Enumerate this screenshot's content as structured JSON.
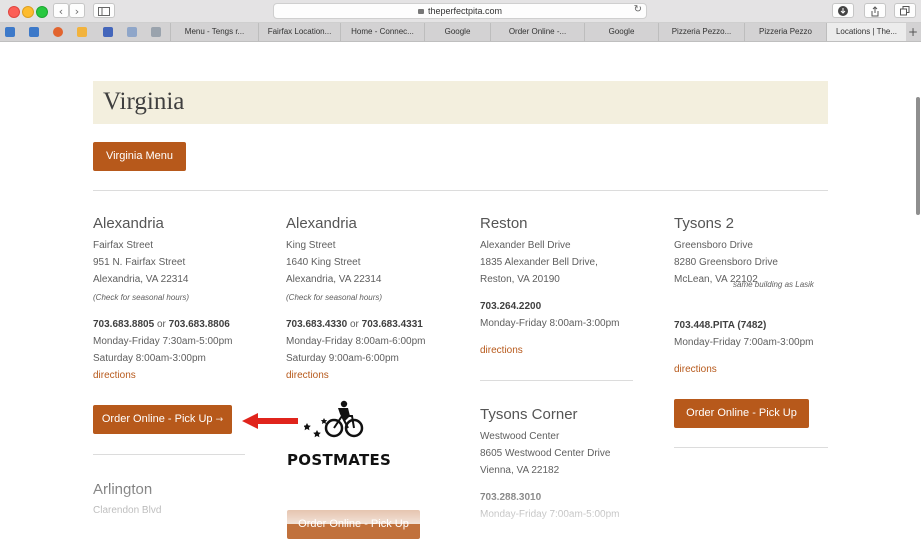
{
  "browser": {
    "url": "theperfectpita.com",
    "tabs": [
      "Menu - Tengs r...",
      "Fairfax Location...",
      "Home - Connec...",
      "Google",
      "Order Online -...",
      "Google",
      "Pizzeria Pezzo...",
      "Pizzeria Pezzo",
      "Locations | The..."
    ]
  },
  "page": {
    "title": "Virginia",
    "menu_button": "Virginia Menu",
    "locations": [
      {
        "city": "Alexandria",
        "street": "Fairfax Street",
        "address": "951 N. Fairfax Street",
        "citystate": "Alexandria, VA 22314",
        "note": "(Check for seasonal hours)",
        "phone1": "703.683.8805",
        "or": "or",
        "phone2": "703.683.8806",
        "hours1": "Monday-Friday 7:30am-5:00pm",
        "hours2": "Saturday 8:00am-3:00pm",
        "directions": "directions",
        "order": "Order Online - Pick Up",
        "arrow": "→"
      },
      {
        "city": "Alexandria",
        "street": "King Street",
        "address": "1640 King Street",
        "citystate": "Alexandria, VA 22314",
        "note": "(Check for seasonal hours)",
        "phone1": "703.683.4330",
        "or": "or",
        "phone2": "703.683.4331",
        "hours1": "Monday-Friday 8:00am-6:00pm",
        "hours2": "Saturday 9:00am-6:00pm",
        "directions": "directions"
      },
      {
        "city": "Reston",
        "street": "Alexander Bell Drive",
        "address": "1835 Alexander Bell Drive,",
        "citystate": "Reston, VA 20190",
        "phone": "703.264.2200",
        "hours": "Monday-Friday 8:00am-3:00pm",
        "directions": "directions"
      },
      {
        "city": "Tysons 2",
        "street": "Greensboro Drive",
        "address": "8280 Greensboro Drive",
        "citystate": "McLean, VA 22102",
        "note": "same building as Lasik",
        "phone": "703.448.PITA (7482)",
        "hours": "Monday-Friday 7:00am-3:00pm",
        "directions": "directions",
        "order": "Order Online - Pick Up"
      },
      {
        "city": "Tysons Corner",
        "street": "Westwood Center",
        "address": "8605 Westwood Center Drive",
        "citystate": "Vienna, VA 22182",
        "phone": "703.288.3010",
        "hours": "Monday-Friday 7:00am-5:00pm"
      },
      {
        "city": "Arlington",
        "street": "Clarendon Blvd"
      }
    ],
    "postmates": "POSTMATES",
    "partial_button": "Order Online - Pick Up"
  },
  "colors": {
    "accent": "#b7591b",
    "header_bg": "#f3efde",
    "annotation_arrow": "#e0241c"
  }
}
